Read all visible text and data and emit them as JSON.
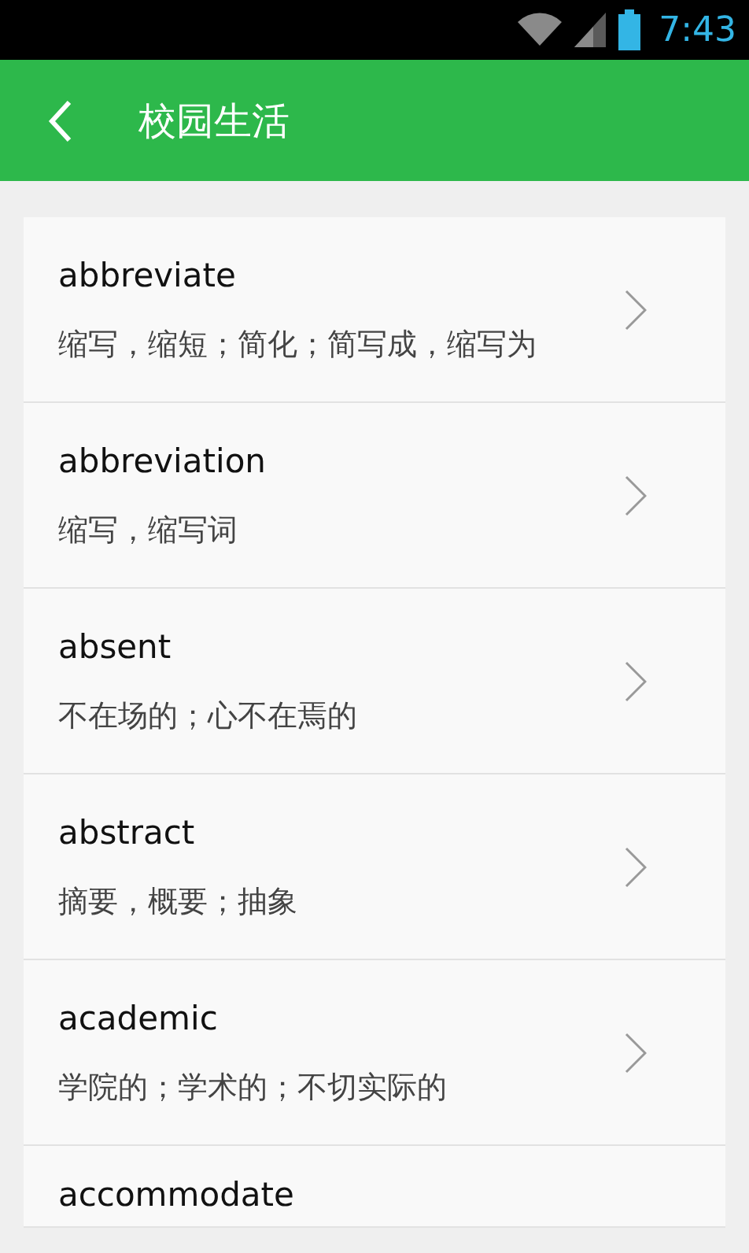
{
  "status_bar": {
    "time": "7:43"
  },
  "header": {
    "title": "校园生活"
  },
  "words": [
    {
      "word": "abbreviate",
      "meaning": "缩写，缩短；简化；简写成，缩写为"
    },
    {
      "word": "abbreviation",
      "meaning": "缩写，缩写词"
    },
    {
      "word": "absent",
      "meaning": "不在场的；心不在焉的"
    },
    {
      "word": "abstract",
      "meaning": "摘要，概要；抽象"
    },
    {
      "word": "academic",
      "meaning": "学院的；学术的；不切实际的"
    },
    {
      "word": "accommodate"
    }
  ]
}
